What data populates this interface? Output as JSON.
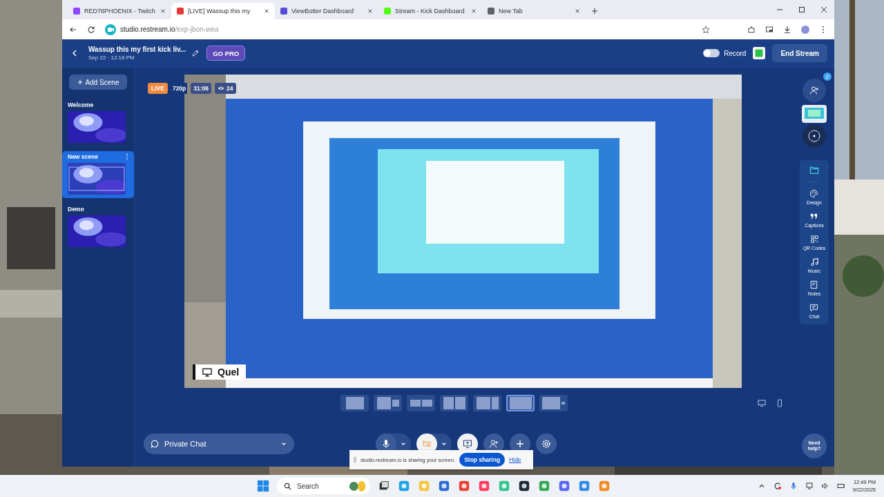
{
  "browser": {
    "tabs": [
      {
        "title": "RED78PHOENIX - Twitch",
        "selected": false,
        "color": "#9146ff"
      },
      {
        "title": "[LIVE] Wassup this my",
        "selected": true,
        "color": "#e53935"
      },
      {
        "title": "ViewBotter Dashboard",
        "selected": false,
        "color": "#5b4bd6"
      },
      {
        "title": "Stream - Kick Dashboard",
        "selected": false,
        "color": "#53fc18"
      },
      {
        "title": "New Tab",
        "selected": false,
        "color": "#5f6368"
      }
    ],
    "address": {
      "host": "studio.restream.io",
      "path": "/exp-jbon-wea"
    }
  },
  "header": {
    "title": "Wassup this my first kick liv...",
    "subtitle": "Sep 22 · 12:18 PM",
    "go_pro": "GO PRO",
    "record": {
      "label": "Record",
      "on": false
    },
    "end_stream": "End Stream"
  },
  "scenes": {
    "add": "Add Scene",
    "items": [
      {
        "name": "Welcome",
        "selected": false
      },
      {
        "name": "New scene",
        "selected": true
      },
      {
        "name": "Demo",
        "selected": false
      }
    ]
  },
  "stage": {
    "live": "LIVE",
    "quality": "720p",
    "time": "31:06",
    "viewers": "24",
    "name_tag": "Quel"
  },
  "layouts": [
    {
      "kind": "single",
      "selected": false
    },
    {
      "kind": "pip",
      "selected": false
    },
    {
      "kind": "split",
      "selected": false
    },
    {
      "kind": "halves",
      "selected": false
    },
    {
      "kind": "wide-side",
      "selected": false
    },
    {
      "kind": "corner",
      "selected": true
    },
    {
      "kind": "side-dot",
      "selected": false
    }
  ],
  "sidebar": {
    "guest_count": "2",
    "tools": [
      {
        "kind": "palette",
        "label": "Design"
      },
      {
        "kind": "quote",
        "label": "Captions"
      },
      {
        "kind": "qr",
        "label": "QR Codes"
      },
      {
        "kind": "music",
        "label": "Music"
      },
      {
        "kind": "notes",
        "label": "Notes"
      },
      {
        "kind": "chat",
        "label": "Chat"
      }
    ]
  },
  "bottom": {
    "chat_channel": "Private Chat",
    "help": "Need help?"
  },
  "share_bar": {
    "message": "studio.restream.io is sharing your screen.",
    "stop": "Stop sharing",
    "hide": "Hide"
  },
  "taskbar": {
    "search": "Search",
    "time": "12:49 PM",
    "date": "9/22/2025"
  }
}
